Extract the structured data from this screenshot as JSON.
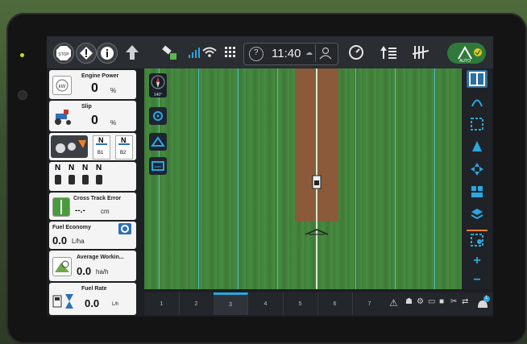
{
  "header": {
    "time": "11:40"
  },
  "left_panel": {
    "engine_power": {
      "label": "Engine Power",
      "value": "0",
      "unit": "%"
    },
    "slip": {
      "label": "Slip",
      "value": "0",
      "unit": "%"
    },
    "hitch": {
      "gear_top": "N",
      "gear_top_sub": "B1",
      "gear_top2": "N",
      "gear_top2_sub": "B2"
    },
    "gears": [
      "N",
      "N",
      "N",
      "N"
    ],
    "cross_track": {
      "label": "Cross Track Error",
      "value": "--.-",
      "unit": "cm"
    },
    "fuel_economy": {
      "label": "Fuel Economy",
      "value": "0.0",
      "unit": "L/ha"
    },
    "average_working": {
      "label": "Average Workin...",
      "value": "0.0",
      "unit": "ha/h"
    },
    "fuel_rate": {
      "label": "Fuel Rate",
      "value": "0.0",
      "unit": "L/h"
    }
  },
  "map": {
    "compass_text": "140°"
  },
  "pages": [
    "1",
    "2",
    "3",
    "4",
    "5",
    "6",
    "7"
  ],
  "active_page": "3",
  "badge": "1"
}
